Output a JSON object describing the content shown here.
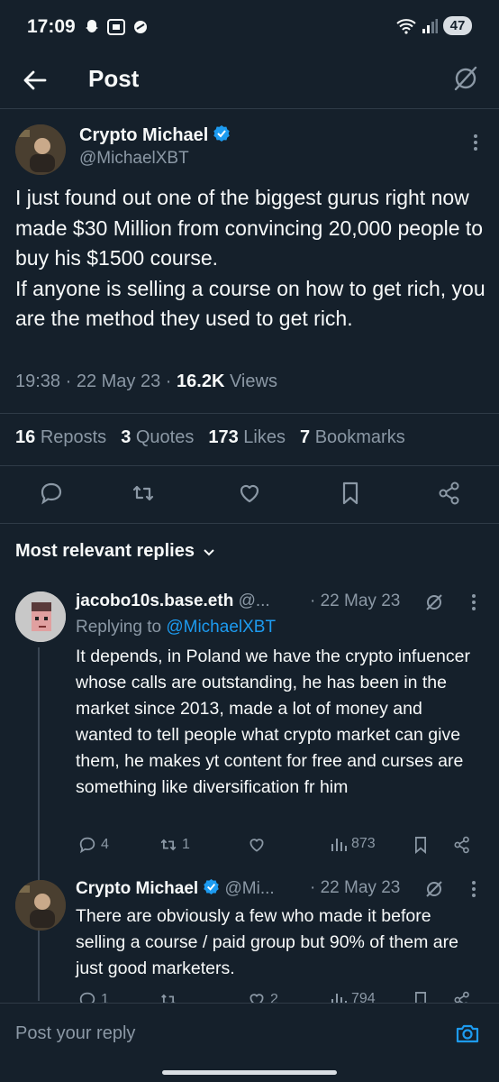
{
  "status_bar": {
    "time": "17:09",
    "battery": "47"
  },
  "header": {
    "title": "Post"
  },
  "post": {
    "author_name": "Crypto Michael",
    "author_handle": "@MichaelXBT",
    "text": "I just found out one of the biggest gurus right now made $30 Million from convincing 20,000 people to buy his $1500 course.\nIf anyone is selling a course on how to get rich, you are the method they used to get rich.",
    "time": "19:38",
    "date": "22 May 23",
    "views_count": "16.2K",
    "views_label": "Views",
    "reposts_count": "16",
    "reposts_label": "Reposts",
    "quotes_count": "3",
    "quotes_label": "Quotes",
    "likes_count": "173",
    "likes_label": "Likes",
    "bookmarks_count": "7",
    "bookmarks_label": "Bookmarks"
  },
  "replies_sort": {
    "label": "Most relevant replies"
  },
  "replies": [
    {
      "author_name": "jacobo10s.base.eth",
      "author_handle": "@...",
      "date": "· 22 May 23",
      "replying_label": "Replying to",
      "replying_handle": "@MichaelXBT",
      "text": "It depends, in Poland we have the crypto infuencer whose calls are outstanding, he has been in the market since 2013, made a lot of money and wanted to tell people what crypto market can give them, he makes yt content for free and curses are something like diversification fr him",
      "reply_count": "4",
      "repost_count": "1",
      "like_count": "",
      "view_count": "873"
    },
    {
      "author_name": "Crypto Michael",
      "author_handle": "@Mi...",
      "date": "· 22 May 23",
      "text": "There are obviously a few who made it before selling a course / paid group but 90% of them are just good marketers.",
      "reply_count": "1",
      "repost_count": "",
      "like_count": "2",
      "view_count": "794"
    }
  ],
  "composer": {
    "placeholder": "Post your reply"
  },
  "colors": {
    "background": "#15202b",
    "accent": "#1d9bf0",
    "muted": "#8b98a5",
    "divider": "#2f3b47"
  }
}
